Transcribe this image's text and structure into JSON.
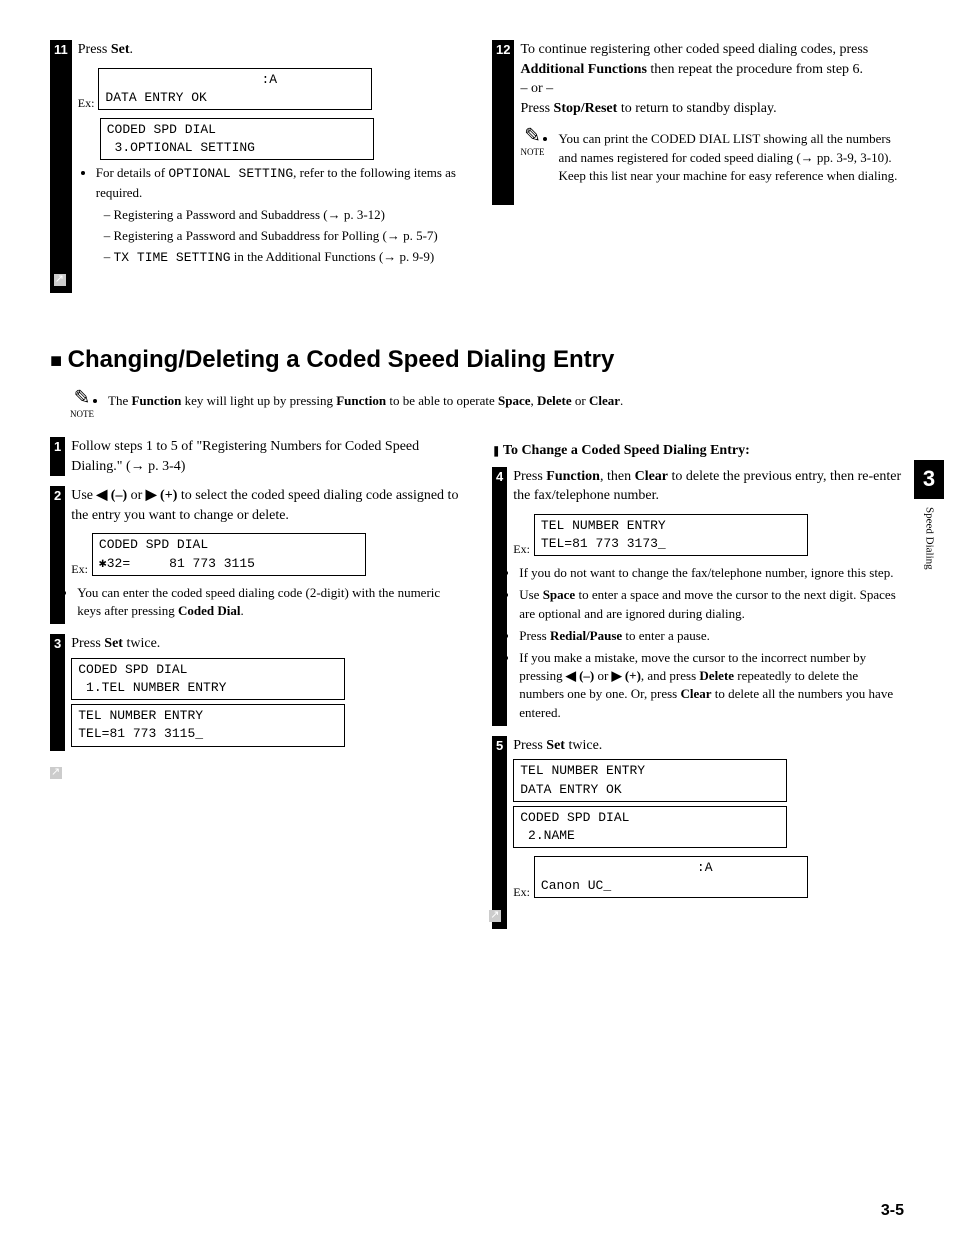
{
  "step11": {
    "num": "11",
    "text_prefix": "Press ",
    "text_bold": "Set",
    "text_suffix": ".",
    "ex_label": "Ex:",
    "lcd1": "                    :A\nDATA ENTRY OK",
    "lcd2": "CODED SPD DIAL\n 3.OPTIONAL SETTING",
    "bullet_prefix": "For details of ",
    "bullet_code": "OPTIONAL SETTING",
    "bullet_suffix": ", refer to the following items as required.",
    "dash1": "– Registering a Password and Subaddress (→ p. 3-12)",
    "dash2": "– Registering a Password and Subaddress for Polling (→ p. 5-7)",
    "dash3_pre": "– ",
    "dash3_code": "TX TIME SETTING",
    "dash3_post": " in the Additional Functions (→ p. 9-9)"
  },
  "step12": {
    "num": "12",
    "line1_pre": "To continue registering other coded speed dialing codes, press ",
    "line1_bold": "Additional Functions",
    "line1_post": " then repeat the procedure from step 6.",
    "or": "– or –",
    "line2_pre": "Press ",
    "line2_bold": "Stop/Reset",
    "line2_post": " to return to standby display.",
    "note": "You can print the CODED DIAL LIST showing all the numbers and names registered for coded speed dialing (→ pp. 3-9, 3-10). Keep this list near your machine for easy reference when dialing."
  },
  "section_heading": "Changing/Deleting a Coded Speed Dialing Entry",
  "top_note_pre": "The ",
  "top_note_b1": "Function",
  "top_note_mid1": " key will light up by pressing ",
  "top_note_b2": "Function",
  "top_note_mid2": " to be able to operate ",
  "top_note_b3": "Space",
  "top_note_sep1": ", ",
  "top_note_b4": "Delete",
  "top_note_sep2": " or ",
  "top_note_b5": "Clear",
  "top_note_end": ".",
  "step1": {
    "num": "1",
    "text": "Follow steps 1 to 5 of \"Registering Numbers for Coded Speed Dialing.\" (→ p. 3-4)"
  },
  "step2": {
    "num": "2",
    "pre": "Use ",
    "b1": "◀ (–)",
    "mid": " or ",
    "b2": "▶ (+)",
    "post": " to select the coded speed dialing code assigned to the entry you want to change or delete.",
    "ex_label": "Ex:",
    "lcd": "CODED SPD DIAL\n✱32=     81 773 3115",
    "bullet_pre": "You can enter the coded speed dialing code (2-digit) with the numeric keys after pressing ",
    "bullet_bold": "Coded Dial",
    "bullet_post": "."
  },
  "step3": {
    "num": "3",
    "pre": "Press ",
    "bold": "Set",
    "post": " twice.",
    "lcd1": "CODED SPD DIAL\n 1.TEL NUMBER ENTRY",
    "lcd2": "TEL NUMBER ENTRY\nTEL=81 773 3115_"
  },
  "subheading": "To Change a Coded Speed Dialing Entry:",
  "step4": {
    "num": "4",
    "pre": "Press ",
    "b1": "Function",
    "mid": ", then ",
    "b2": "Clear",
    "post": " to delete the previous entry, then re-enter the fax/telephone number.",
    "ex_label": "Ex:",
    "lcd": "TEL NUMBER ENTRY\nTEL=81 773 3173_",
    "bullet1": "If you do not want to change the fax/telephone number, ignore this step.",
    "bullet2_pre": "Use ",
    "bullet2_b": "Space",
    "bullet2_post": " to enter a space and move the cursor to the next digit. Spaces are optional and are ignored during dialing.",
    "bullet3_pre": "Press ",
    "bullet3_b": "Redial/Pause",
    "bullet3_post": " to enter a pause.",
    "bullet4_pre": "If you make a mistake, move the cursor to the incorrect number by pressing ",
    "bullet4_b1": "◀ (–)",
    "bullet4_mid1": " or ",
    "bullet4_b2": "▶ (+)",
    "bullet4_mid2": ", and press ",
    "bullet4_b3": "Delete",
    "bullet4_mid3": " repeatedly to delete the numbers one by one. Or, press ",
    "bullet4_b4": "Clear",
    "bullet4_post": " to delete all the numbers you have entered."
  },
  "step5": {
    "num": "5",
    "pre": "Press ",
    "bold": "Set",
    "post": " twice.",
    "lcd1": "TEL NUMBER ENTRY\nDATA ENTRY OK",
    "lcd2": "CODED SPD DIAL\n 2.NAME",
    "ex_label": "Ex:",
    "lcd3": "                    :A\nCanon UC_"
  },
  "side": {
    "num": "3",
    "text": "Speed Dialing"
  },
  "page_num": "3-5",
  "note_label": "NOTE"
}
